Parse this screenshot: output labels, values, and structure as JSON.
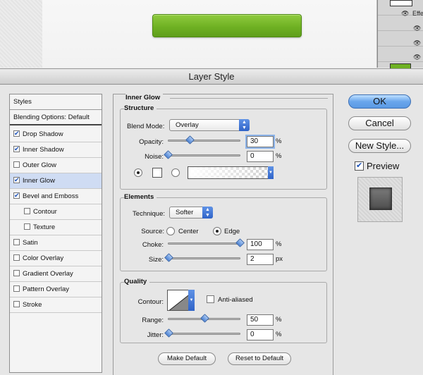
{
  "background": {
    "layers_effects_label": "Effe"
  },
  "dialog": {
    "title": "Layer Style",
    "styles_list": {
      "header": "Styles",
      "blending": "Blending Options: Default",
      "items": [
        {
          "label": "Drop Shadow",
          "checked": true
        },
        {
          "label": "Inner Shadow",
          "checked": true
        },
        {
          "label": "Outer Glow",
          "checked": false
        },
        {
          "label": "Inner Glow",
          "checked": true
        },
        {
          "label": "Bevel and Emboss",
          "checked": true
        },
        {
          "label": "Contour",
          "checked": false
        },
        {
          "label": "Texture",
          "checked": false
        },
        {
          "label": "Satin",
          "checked": false
        },
        {
          "label": "Color Overlay",
          "checked": false
        },
        {
          "label": "Gradient Overlay",
          "checked": false
        },
        {
          "label": "Pattern Overlay",
          "checked": false
        },
        {
          "label": "Stroke",
          "checked": false
        }
      ]
    },
    "inner_glow": {
      "title": "Inner Glow",
      "structure": {
        "title": "Structure",
        "blend_mode_label": "Blend Mode:",
        "blend_mode_value": "Overlay",
        "opacity_label": "Opacity:",
        "opacity_value": "30",
        "noise_label": "Noise:",
        "noise_value": "0",
        "percent": "%"
      },
      "elements": {
        "title": "Elements",
        "technique_label": "Technique:",
        "technique_value": "Softer",
        "source_label": "Source:",
        "source_center": "Center",
        "source_edge": "Edge",
        "choke_label": "Choke:",
        "choke_value": "100",
        "size_label": "Size:",
        "size_value": "2",
        "percent": "%",
        "px": "px"
      },
      "quality": {
        "title": "Quality",
        "contour_label": "Contour:",
        "anti_aliased_label": "Anti-aliased",
        "range_label": "Range:",
        "range_value": "50",
        "jitter_label": "Jitter:",
        "jitter_value": "0",
        "percent": "%"
      },
      "make_default": "Make Default",
      "reset_default": "Reset to Default"
    },
    "buttons": {
      "ok": "OK",
      "cancel": "Cancel",
      "new_style": "New Style...",
      "preview_label": "Preview"
    },
    "colors": {
      "accent": "#3c6fb4",
      "selected_row": "#cfdcf3",
      "green_button": "#6fb123"
    }
  }
}
